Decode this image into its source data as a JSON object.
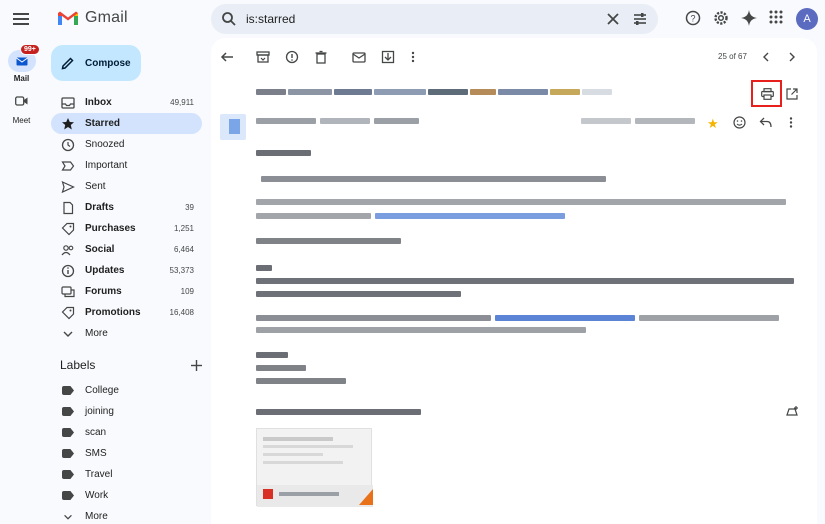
{
  "app": {
    "name": "Gmail"
  },
  "search": {
    "query": "is:starred"
  },
  "rail": {
    "mail": {
      "label": "Mail",
      "badge": "99+"
    },
    "meet": {
      "label": "Meet"
    }
  },
  "compose_label": "Compose",
  "nav": [
    {
      "label": "Inbox",
      "count": "49,911",
      "bold": true,
      "icon": "inbox-icon"
    },
    {
      "label": "Starred",
      "count": "",
      "bold": true,
      "active": true,
      "icon": "star-icon"
    },
    {
      "label": "Snoozed",
      "count": "",
      "bold": false,
      "icon": "clock-icon"
    },
    {
      "label": "Important",
      "count": "",
      "bold": false,
      "icon": "important-icon"
    },
    {
      "label": "Sent",
      "count": "",
      "bold": false,
      "icon": "send-icon"
    },
    {
      "label": "Drafts",
      "count": "39",
      "bold": true,
      "icon": "draft-icon"
    },
    {
      "label": "Purchases",
      "count": "1,251",
      "bold": true,
      "icon": "tag-icon"
    },
    {
      "label": "Social",
      "count": "6,464",
      "bold": true,
      "icon": "people-icon"
    },
    {
      "label": "Updates",
      "count": "53,373",
      "bold": true,
      "icon": "info-icon"
    },
    {
      "label": "Forums",
      "count": "109",
      "bold": true,
      "icon": "forum-icon"
    },
    {
      "label": "Promotions",
      "count": "16,408",
      "bold": true,
      "icon": "tag-icon"
    },
    {
      "label": "More",
      "count": "",
      "bold": false,
      "icon": "chevron-down-icon"
    }
  ],
  "labels_title": "Labels",
  "labels": [
    "College",
    "joining",
    "scan",
    "SMS",
    "Travel",
    "Work"
  ],
  "labels_more": "More",
  "pager": "25 of 67",
  "colors": {
    "accent": "#c2e7ff",
    "active_nav": "#d3e3fd",
    "highlight": "#e8201d",
    "star": "#f4b400"
  }
}
